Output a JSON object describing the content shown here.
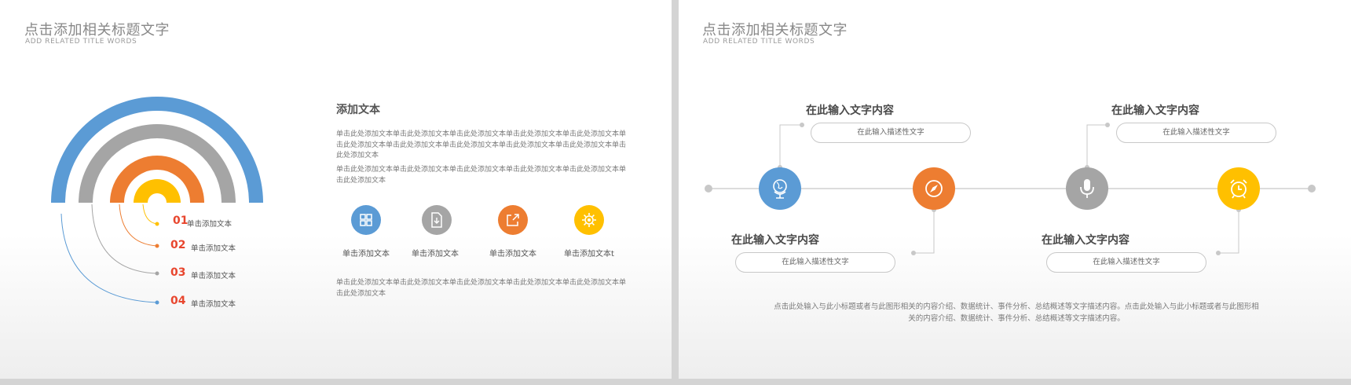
{
  "left_slide": {
    "title": "点击添加相关标题文字",
    "subtitle": "ADD RELATED  TITLE  WORDS",
    "list": [
      {
        "number": "01",
        "label": "单击添加文本"
      },
      {
        "number": "02",
        "label": "单击添加文本"
      },
      {
        "number": "03",
        "label": "单击添加文本"
      },
      {
        "number": "04",
        "label": "单击添加文本"
      }
    ],
    "section_heading": "添加文本",
    "paragraph1": "单击此处添加文本单击此处添加文本单击此处添加文本单击此处添加文本单击此处添加文本单击此处添加文本单击此处添加文本单击此处添加文本单击此处添加文本单击此处添加文本单击此处添加文本",
    "paragraph2": "单击此处添加文本单击此处添加文本单击此处添加文本单击此处添加文本单击此处添加文本单击此处添加文本",
    "icons": [
      {
        "icon": "grid-icon",
        "color": "#5b9bd5",
        "label": "单击添加文本"
      },
      {
        "icon": "document-icon",
        "color": "#a5a5a5",
        "label": "单击添加文本"
      },
      {
        "icon": "share-icon",
        "color": "#ed7d31",
        "label": "单击添加文本"
      },
      {
        "icon": "gear-icon",
        "color": "#ffc000",
        "label": "单击添加文本t"
      }
    ],
    "paragraph3": "单击此处添加文本单击此处添加文本单击此处添加文本单击此处添加文本单击此处添加文本单击此处添加文本"
  },
  "right_slide": {
    "title": "点击添加相关标题文字",
    "subtitle": "ADD RELATED  TITLE  WORDS",
    "timeline": [
      {
        "icon": "globe-icon",
        "color": "#5b9bd5",
        "heading": "在此输入文字内容",
        "desc": "在此输入描述性文字"
      },
      {
        "icon": "compass-icon",
        "color": "#ed7d31",
        "heading": "在此输入文字内容",
        "desc": "在此输入描述性文字"
      },
      {
        "icon": "microphone-icon",
        "color": "#a5a5a5",
        "heading": "在此输入文字内容",
        "desc": "在此输入描述性文字"
      },
      {
        "icon": "alarm-clock-icon",
        "color": "#ffc000",
        "heading": "在此输入文字内容",
        "desc": "在此输入描述性文字"
      }
    ],
    "footer": "点击此处输入与此小标题或者与此图形相关的内容介绍、数据统计、事件分析、总结概述等文字描述内容。点击此处输入与此小标题或者与此图形相关的内容介绍、数据统计、事件分析、总结概述等文字描述内容。"
  },
  "colors": {
    "blue": "#5b9bd5",
    "gray": "#a5a5a5",
    "orange": "#ed7d31",
    "yellow": "#ffc000",
    "red": "#e8462e"
  }
}
